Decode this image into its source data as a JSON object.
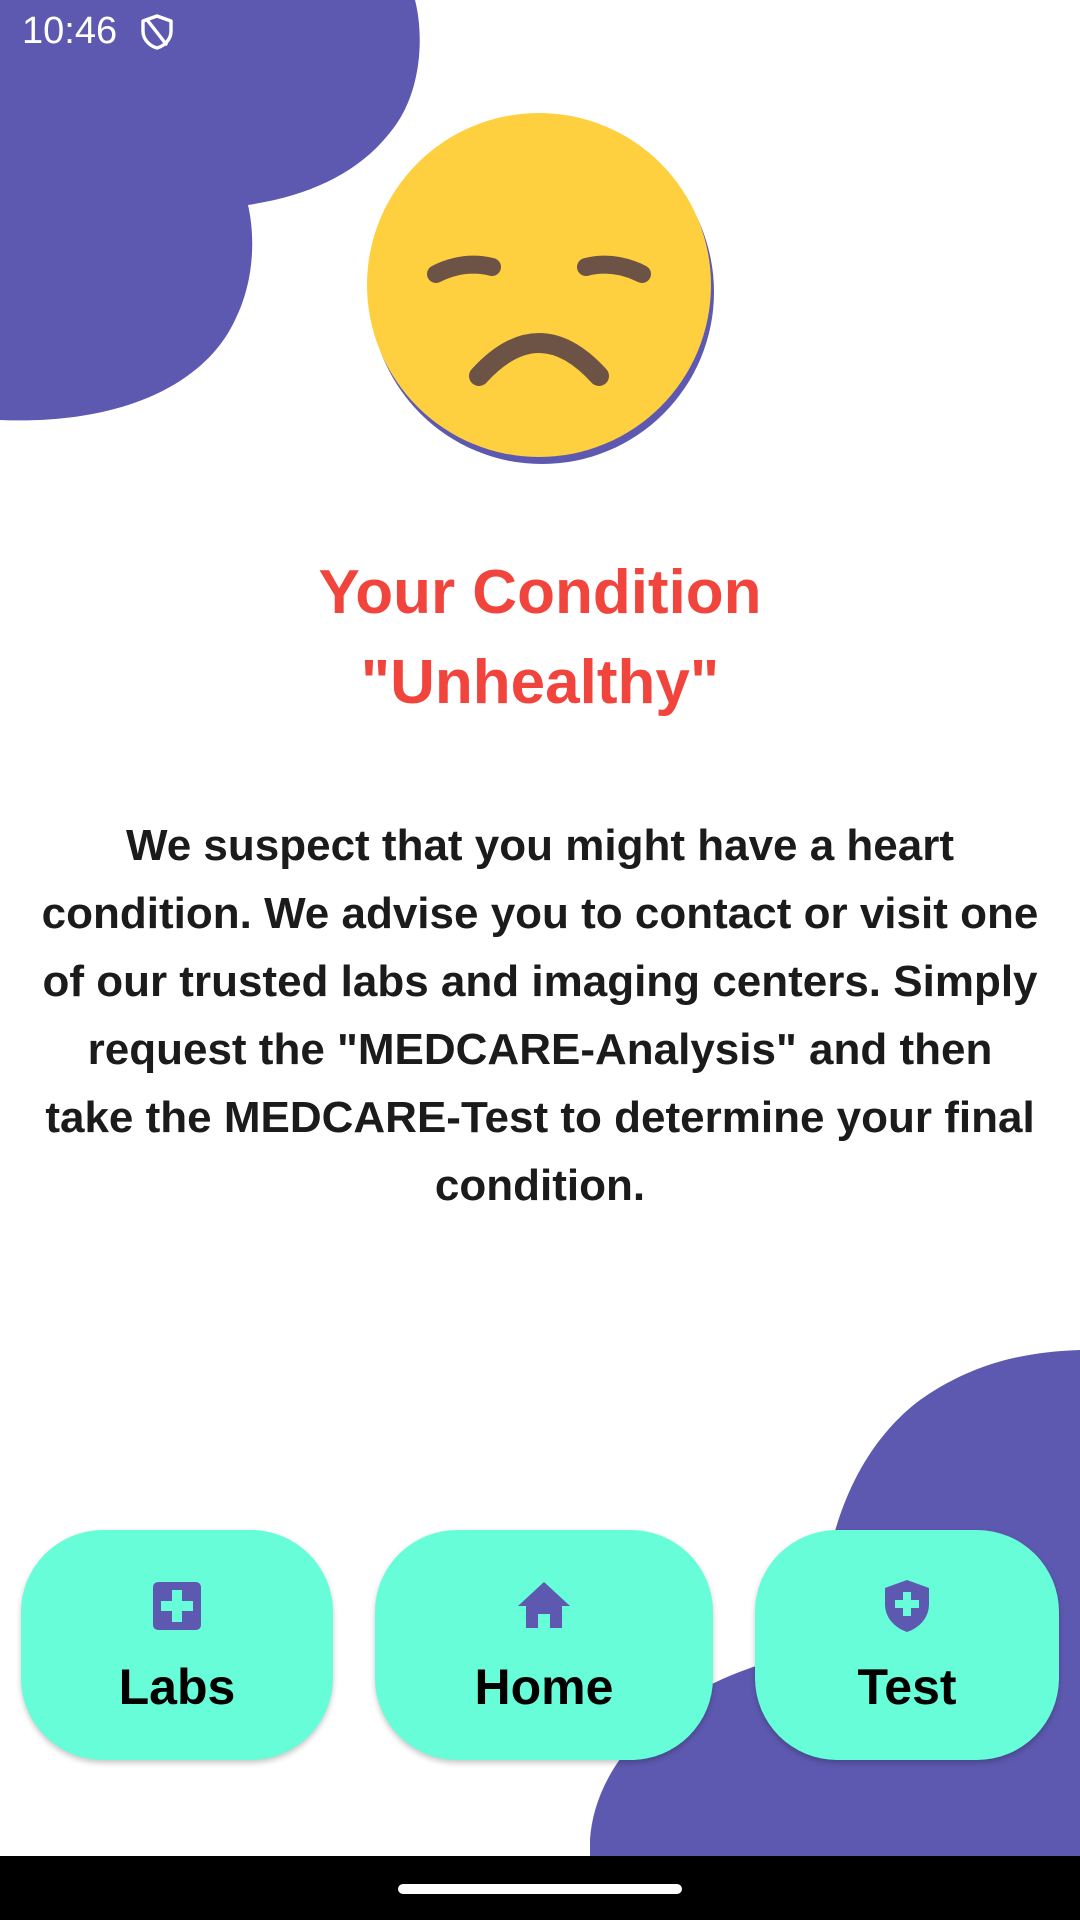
{
  "status_bar": {
    "time": "10:46",
    "icons": [
      "shield-icon"
    ]
  },
  "emoji": "sad-face-icon",
  "condition": {
    "title": "Your Condition",
    "status": "\"Unhealthy\""
  },
  "message": "We suspect that you might have a heart condition. We advise you to contact or visit one of our trusted labs and imaging centers. Simply request the \"MEDCARE-Analysis\" and then take the MEDCARE-Test to determine your final condition.",
  "nav": {
    "labs": {
      "label": "Labs",
      "icon": "medical-plus-icon"
    },
    "home": {
      "label": "Home",
      "icon": "home-icon"
    },
    "test": {
      "label": "Test",
      "icon": "shield-plus-icon"
    }
  },
  "colors": {
    "accent_purple": "#5d59b0",
    "button_mint": "#66fdd8",
    "alert_red": "#f0443d",
    "emoji_yellow": "#fecf3e"
  }
}
